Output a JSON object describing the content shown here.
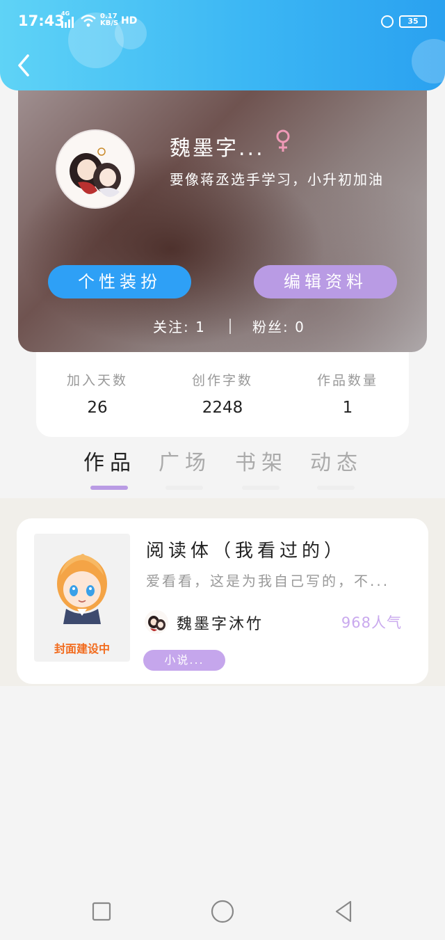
{
  "status_bar": {
    "time": "17:43",
    "network": "4G",
    "speed_value": "0.17",
    "speed_unit": "KB/S",
    "hd": "HD",
    "battery": "35",
    "icons": [
      "signal-icon",
      "wifi-icon",
      "alarm-icon",
      "battery-icon"
    ]
  },
  "header": {
    "back_icon": "chevron-left-icon",
    "gradient": [
      "#5fd3f6",
      "#2aa1f0"
    ]
  },
  "profile": {
    "username": "魏墨字...",
    "gender_symbol": "♀",
    "signature": "要像蒋丞选手学习，小升初加油",
    "buttons": {
      "dress_up": "个性装扮",
      "edit_profile": "编辑资料"
    },
    "follow_label": "关注: 1",
    "fans_label": "粉丝: 0"
  },
  "stats": [
    {
      "label": "加入天数",
      "value": "26"
    },
    {
      "label": "创作字数",
      "value": "2248"
    },
    {
      "label": "作品数量",
      "value": "1"
    }
  ],
  "tabs": [
    {
      "label": "作品",
      "active": true
    },
    {
      "label": "广场",
      "active": false
    },
    {
      "label": "书架",
      "active": false
    },
    {
      "label": "动态",
      "active": false
    }
  ],
  "works": [
    {
      "cover_text": "封面建设中",
      "title": "阅读体（我看过的）",
      "description": "爱看看，这是为我自己写的，不...",
      "author": "魏墨字沐竹",
      "popularity": "968人气",
      "category": "小说..."
    }
  ],
  "nav": {
    "icons": [
      "recent-apps-icon",
      "home-icon",
      "back-triangle-icon"
    ]
  },
  "colors": {
    "accent_blue": "#2ea0f6",
    "accent_purple": "#b99be4",
    "popularity": "#c9a9ee",
    "cover_text": "#f26b1d"
  }
}
